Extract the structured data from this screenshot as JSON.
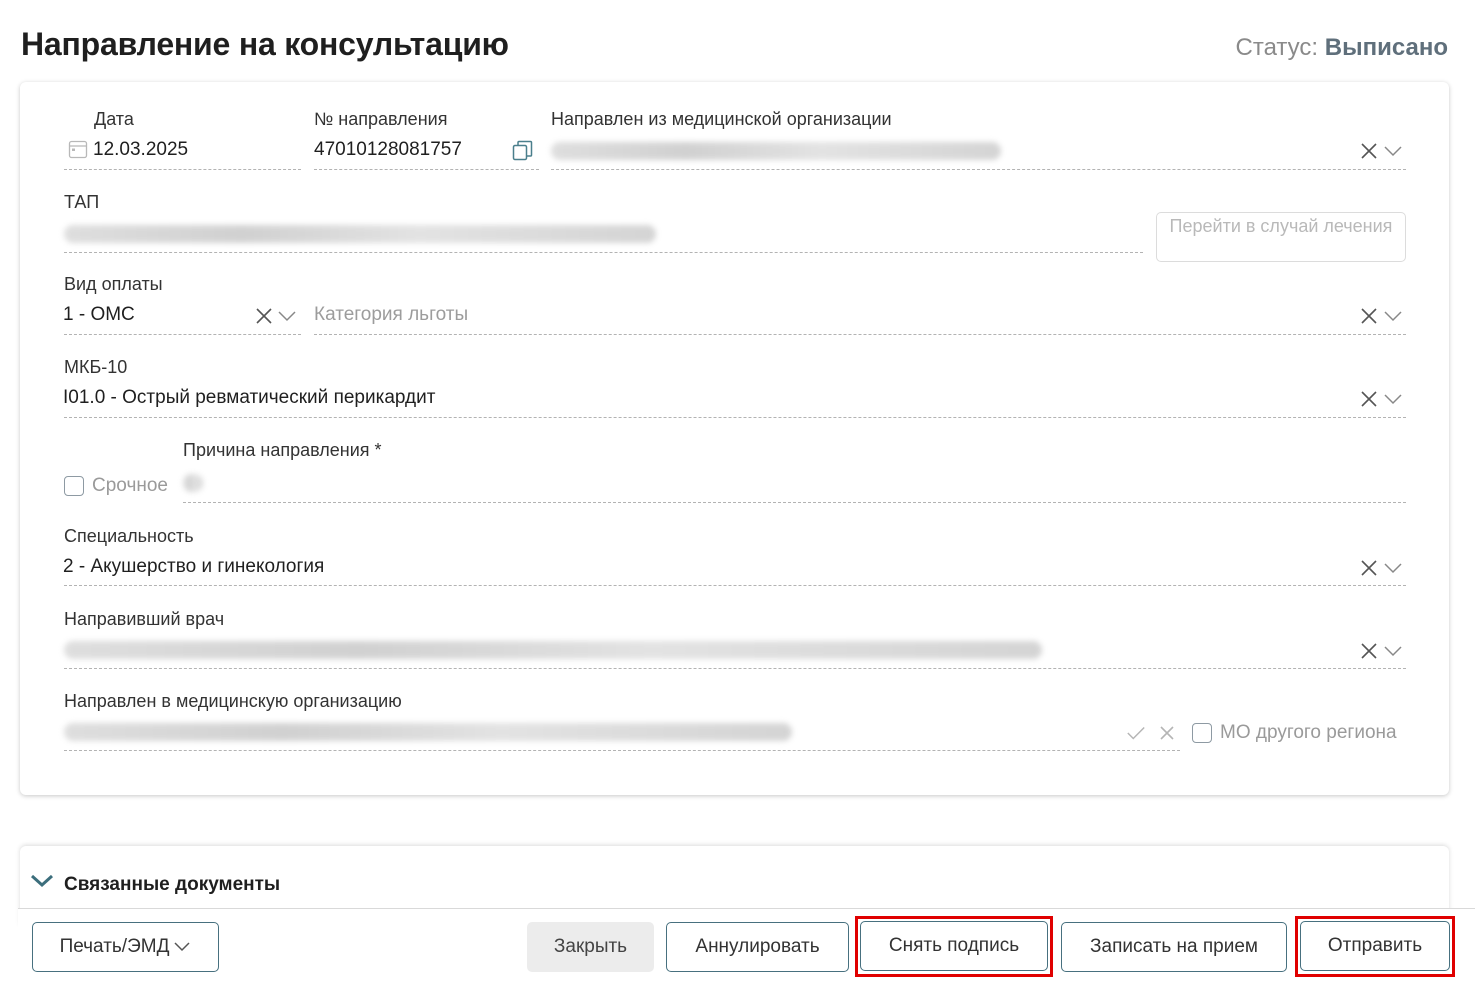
{
  "header": {
    "title": "Направление на консультацию",
    "status_label": "Статус:",
    "status_value": "Выписано"
  },
  "form": {
    "date": {
      "label": "Дата",
      "value": "12.03.2025"
    },
    "referral_number": {
      "label": "№ направления",
      "value": "47010128081757"
    },
    "from_org": {
      "label": "Направлен из медицинской организации"
    },
    "tap": {
      "label": "ТАП",
      "go_button": "Перейти в случай лечения"
    },
    "payment_type": {
      "label": "Вид оплаты",
      "value": "1 - ОМС"
    },
    "benefit_category": {
      "placeholder": "Категория льготы"
    },
    "mkb10": {
      "label": "МКБ-10",
      "value": "I01.0 - Острый ревматический перикардит"
    },
    "urgent": {
      "label": "Срочное",
      "checked": false
    },
    "reason": {
      "label": "Причина направления *"
    },
    "specialty": {
      "label": "Специальность",
      "value": "2 - Акушерство и гинекология"
    },
    "doctor": {
      "label": "Направивший врач"
    },
    "to_org": {
      "label": "Направлен в медицинскую организацию"
    },
    "other_region": {
      "label": "МО другого региона",
      "checked": false
    }
  },
  "related_documents": {
    "title": "Связанные документы"
  },
  "footer": {
    "print_button": "Печать/ЭМД",
    "close_button": "Закрыть",
    "cancel_button": "Аннулировать",
    "unsign_button": "Снять подпись",
    "appointment_button": "Записать на прием",
    "send_button": "Отправить"
  },
  "colors": {
    "accent": "#47707f",
    "highlight_frame": "#e00000",
    "status_value": "#5f6f7b"
  }
}
